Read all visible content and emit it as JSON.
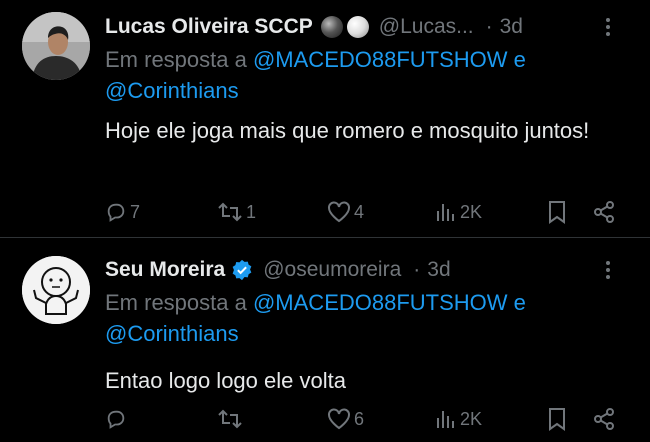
{
  "tweets": [
    {
      "name": "Lucas Oliveira SCCP",
      "handle": "@Lucas...",
      "dot": "·",
      "time": "3d",
      "reply_prefix": "Em resposta a",
      "mention1": "@MACEDO88FUTSHOW",
      "reply_and": "e",
      "mention2": "@Corinthians",
      "text": "Hoje ele joga mais que romero e mosquito juntos!",
      "replies": "7",
      "retweets": "1",
      "likes": "4",
      "views": "2K"
    },
    {
      "name": "Seu Moreira",
      "handle": "@oseumoreira",
      "dot": "·",
      "time": "3d",
      "reply_prefix": "Em resposta a",
      "mention1": "@MACEDO88FUTSHOW",
      "reply_and": "e",
      "mention2": "@Corinthians",
      "text": "Entao logo logo ele volta",
      "replies": "",
      "retweets": "",
      "likes": "6",
      "views": "2K"
    }
  ],
  "colors": {
    "background": "#000000",
    "text": "#e7e9ea",
    "muted": "#71767b",
    "link": "#1d9bf0",
    "verified": "#1d9bf0"
  },
  "icons": [
    "reply-icon",
    "retweet-icon",
    "like-icon",
    "views-icon",
    "bookmark-icon",
    "share-icon",
    "more-icon",
    "verified-icon"
  ]
}
